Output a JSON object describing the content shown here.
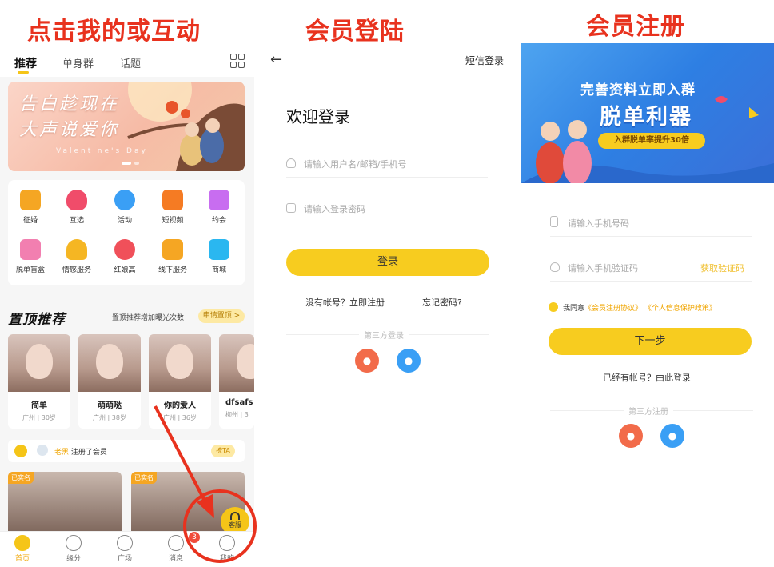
{
  "titles": {
    "panel1": "点击我的或互动",
    "panel2": "会员登陆",
    "panel3": "会员注册"
  },
  "home": {
    "tabs": [
      "推荐",
      "单身群",
      "话题"
    ],
    "active_tab": "推荐",
    "banner_text_line1": "告白趁现在",
    "banner_text_line2": "大声说爱你",
    "banner_sub": "Valentine's Day",
    "menu": [
      {
        "label": "征婚",
        "color": "#f5a623"
      },
      {
        "label": "互选",
        "color": "#f04c6a"
      },
      {
        "label": "活动",
        "color": "#3a9ff5"
      },
      {
        "label": "短视频",
        "color": "#f57b23"
      },
      {
        "label": "约会",
        "color": "#c86df0"
      },
      {
        "label": "脱单盲盒",
        "color": "#f27fb0"
      },
      {
        "label": "情感服务",
        "color": "#f5b623"
      },
      {
        "label": "红娘高",
        "color": "#f0505a"
      },
      {
        "label": "线下服务",
        "color": "#f5a623"
      },
      {
        "label": "商城",
        "color": "#2ab7f0"
      }
    ],
    "section_title": "置顶推荐",
    "section_desc": "置顶推荐增加曝光次数",
    "section_btn": "申请置顶 >",
    "profiles": [
      {
        "name": "简单",
        "info": "广州 | 30岁"
      },
      {
        "name": "萌萌哒",
        "info": "广州 | 38岁"
      },
      {
        "name": "你的爱人",
        "info": "广州 | 36岁"
      },
      {
        "name": "dfsafs",
        "info": "柳州 | 3"
      }
    ],
    "notice_name": "老黑",
    "notice_text": "注册了会员",
    "notice_btn": "撩TA",
    "verified_tag": "已实名",
    "service_label": "客服",
    "nav": [
      "首页",
      "缘分",
      "广场",
      "消息",
      "我的"
    ],
    "msg_badge": "3"
  },
  "login": {
    "back_icon": "arrow-left-icon",
    "sms_login": "短信登录",
    "welcome": "欢迎登录",
    "username_placeholder": "请输入用户名/邮箱/手机号",
    "password_placeholder": "请输入登录密码",
    "login_btn": "登录",
    "register_link": "没有帐号？立即注册",
    "forgot_link": "忘记密码?",
    "third_party": "第三方登录"
  },
  "register": {
    "banner_line1": "完善资料立即入群",
    "banner_line2": "脱单利器",
    "banner_pill": "入群脱单率提升30倍",
    "phone_placeholder": "请输入手机号码",
    "code_placeholder": "请输入手机验证码",
    "get_code": "获取验证码",
    "agree_prefix": "我同意",
    "agree_link1": "《会员注册协议》",
    "agree_link2": "《个人信息保护政策》",
    "next_btn": "下一步",
    "login_link": "已经有帐号？由此登录",
    "third_party": "第三方注册"
  },
  "colors": {
    "accent": "#f7cc1f",
    "annotation_red": "#e8321e",
    "weibo": "#f26b4a",
    "qq": "#3a9ff5"
  }
}
